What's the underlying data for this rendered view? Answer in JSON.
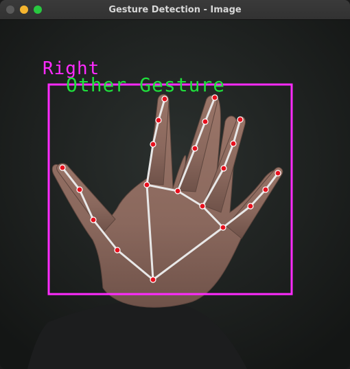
{
  "window": {
    "title": "Gesture Detection - Image",
    "controls": {
      "close_color": "#5a5a5a",
      "minimize_color": "#f5b52f",
      "zoom_color": "#28c840"
    }
  },
  "detection": {
    "handedness": "Right",
    "handedness_color": "#ff2bff",
    "gesture": "Other Gesture",
    "gesture_color": "#1fe03c",
    "bbox_color": "#ff2bff",
    "landmark_color": "#e8101e",
    "connection_color": "#e8e8e8"
  }
}
